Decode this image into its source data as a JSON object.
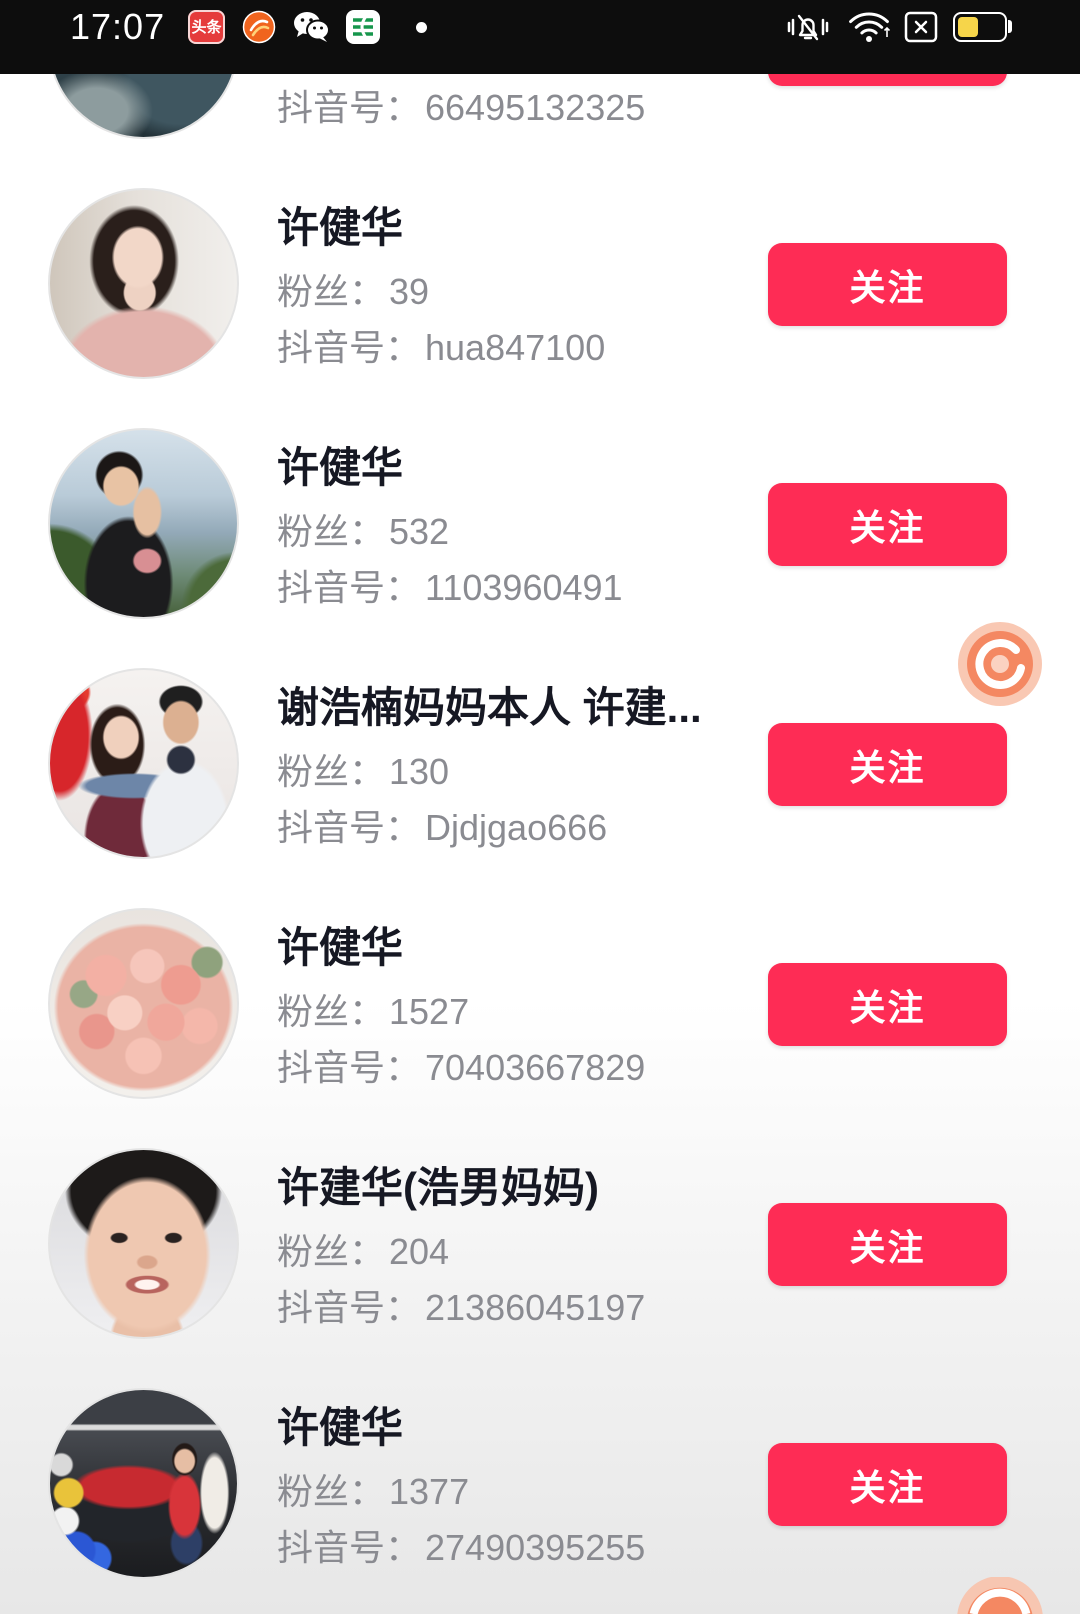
{
  "status_bar": {
    "time": "17:07",
    "toutiao_icon_text": "头条",
    "notification_icons": [
      "toutiao-app-icon",
      "orange-app-icon",
      "wechat-icon",
      "post-app-icon",
      "more-notifications-dot-icon"
    ],
    "system_icons": [
      "mute-icon",
      "wifi-icon",
      "no-sim-icon",
      "battery-icon"
    ],
    "battery_level": 0.45
  },
  "theme": {
    "accent": "#fe2c55",
    "name_color": "#161823",
    "meta_color": "#8a8b91"
  },
  "labels": {
    "fans": "粉丝：",
    "douyin_id": "抖音号：",
    "follow": "关注"
  },
  "results": [
    {
      "douyin_id": "66495132325"
    },
    {
      "name": "许健华",
      "fans": "39",
      "douyin_id": "hua847100"
    },
    {
      "name": "许健华",
      "fans": "532",
      "douyin_id": "1103960491"
    },
    {
      "name": "谢浩楠妈妈本人 许建...",
      "fans": "130",
      "douyin_id": "Djdjgao666"
    },
    {
      "name": "许健华",
      "fans": "1527",
      "douyin_id": "70403667829"
    },
    {
      "name": "许建华(浩男妈妈)",
      "fans": "204",
      "douyin_id": "21386045197"
    },
    {
      "name": "许健华",
      "fans": "1377",
      "douyin_id": "27490395255"
    }
  ],
  "floating_icons": [
    "assistant-icon",
    "assistant-icon"
  ]
}
